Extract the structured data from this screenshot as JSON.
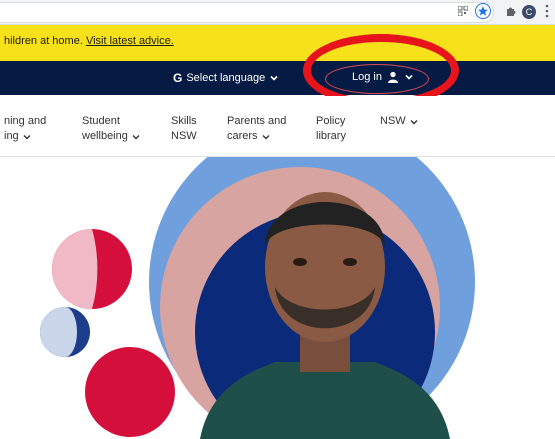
{
  "browser": {
    "profile_initial": "C",
    "accent": "#1a73e8"
  },
  "alert": {
    "text": "hildren at home.",
    "link": "Visit latest advice."
  },
  "top_nav": {
    "language_label": "Select language",
    "login_label": "Log in"
  },
  "main_nav": {
    "items": [
      {
        "line1": "ning and",
        "line2": "ing"
      },
      {
        "line1": "Student",
        "line2": "wellbeing"
      },
      {
        "line1": "Skills",
        "line2": "NSW"
      },
      {
        "line1": "Parents and",
        "line2": "carers"
      },
      {
        "line1": "Policy",
        "line2": "library"
      },
      {
        "line1": "",
        "line2": "NSW"
      }
    ]
  },
  "colors": {
    "alert_bg": "#f7e11a",
    "nav_bg": "#061b43",
    "highlight": "#e8141b",
    "hero_blue": "#6f9fdc",
    "hero_pink": "#d7a4a2",
    "hero_navy": "#0c2a7a",
    "hero_red": "#d40f3c"
  }
}
